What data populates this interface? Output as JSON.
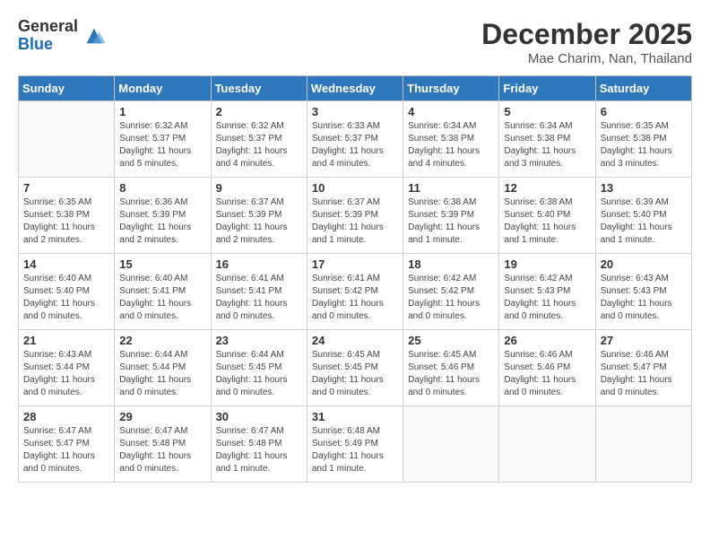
{
  "header": {
    "logo_general": "General",
    "logo_blue": "Blue",
    "month_title": "December 2025",
    "location": "Mae Charim, Nan, Thailand"
  },
  "days_of_week": [
    "Sunday",
    "Monday",
    "Tuesday",
    "Wednesday",
    "Thursday",
    "Friday",
    "Saturday"
  ],
  "weeks": [
    [
      {
        "day": "",
        "content": ""
      },
      {
        "day": "1",
        "content": "Sunrise: 6:32 AM\nSunset: 5:37 PM\nDaylight: 11 hours\nand 5 minutes."
      },
      {
        "day": "2",
        "content": "Sunrise: 6:32 AM\nSunset: 5:37 PM\nDaylight: 11 hours\nand 4 minutes."
      },
      {
        "day": "3",
        "content": "Sunrise: 6:33 AM\nSunset: 5:37 PM\nDaylight: 11 hours\nand 4 minutes."
      },
      {
        "day": "4",
        "content": "Sunrise: 6:34 AM\nSunset: 5:38 PM\nDaylight: 11 hours\nand 4 minutes."
      },
      {
        "day": "5",
        "content": "Sunrise: 6:34 AM\nSunset: 5:38 PM\nDaylight: 11 hours\nand 3 minutes."
      },
      {
        "day": "6",
        "content": "Sunrise: 6:35 AM\nSunset: 5:38 PM\nDaylight: 11 hours\nand 3 minutes."
      }
    ],
    [
      {
        "day": "7",
        "content": "Sunrise: 6:35 AM\nSunset: 5:38 PM\nDaylight: 11 hours\nand 2 minutes."
      },
      {
        "day": "8",
        "content": "Sunrise: 6:36 AM\nSunset: 5:39 PM\nDaylight: 11 hours\nand 2 minutes."
      },
      {
        "day": "9",
        "content": "Sunrise: 6:37 AM\nSunset: 5:39 PM\nDaylight: 11 hours\nand 2 minutes."
      },
      {
        "day": "10",
        "content": "Sunrise: 6:37 AM\nSunset: 5:39 PM\nDaylight: 11 hours\nand 1 minute."
      },
      {
        "day": "11",
        "content": "Sunrise: 6:38 AM\nSunset: 5:39 PM\nDaylight: 11 hours\nand 1 minute."
      },
      {
        "day": "12",
        "content": "Sunrise: 6:38 AM\nSunset: 5:40 PM\nDaylight: 11 hours\nand 1 minute."
      },
      {
        "day": "13",
        "content": "Sunrise: 6:39 AM\nSunset: 5:40 PM\nDaylight: 11 hours\nand 1 minute."
      }
    ],
    [
      {
        "day": "14",
        "content": "Sunrise: 6:40 AM\nSunset: 5:40 PM\nDaylight: 11 hours\nand 0 minutes."
      },
      {
        "day": "15",
        "content": "Sunrise: 6:40 AM\nSunset: 5:41 PM\nDaylight: 11 hours\nand 0 minutes."
      },
      {
        "day": "16",
        "content": "Sunrise: 6:41 AM\nSunset: 5:41 PM\nDaylight: 11 hours\nand 0 minutes."
      },
      {
        "day": "17",
        "content": "Sunrise: 6:41 AM\nSunset: 5:42 PM\nDaylight: 11 hours\nand 0 minutes."
      },
      {
        "day": "18",
        "content": "Sunrise: 6:42 AM\nSunset: 5:42 PM\nDaylight: 11 hours\nand 0 minutes."
      },
      {
        "day": "19",
        "content": "Sunrise: 6:42 AM\nSunset: 5:43 PM\nDaylight: 11 hours\nand 0 minutes."
      },
      {
        "day": "20",
        "content": "Sunrise: 6:43 AM\nSunset: 5:43 PM\nDaylight: 11 hours\nand 0 minutes."
      }
    ],
    [
      {
        "day": "21",
        "content": "Sunrise: 6:43 AM\nSunset: 5:44 PM\nDaylight: 11 hours\nand 0 minutes."
      },
      {
        "day": "22",
        "content": "Sunrise: 6:44 AM\nSunset: 5:44 PM\nDaylight: 11 hours\nand 0 minutes."
      },
      {
        "day": "23",
        "content": "Sunrise: 6:44 AM\nSunset: 5:45 PM\nDaylight: 11 hours\nand 0 minutes."
      },
      {
        "day": "24",
        "content": "Sunrise: 6:45 AM\nSunset: 5:45 PM\nDaylight: 11 hours\nand 0 minutes."
      },
      {
        "day": "25",
        "content": "Sunrise: 6:45 AM\nSunset: 5:46 PM\nDaylight: 11 hours\nand 0 minutes."
      },
      {
        "day": "26",
        "content": "Sunrise: 6:46 AM\nSunset: 5:46 PM\nDaylight: 11 hours\nand 0 minutes."
      },
      {
        "day": "27",
        "content": "Sunrise: 6:46 AM\nSunset: 5:47 PM\nDaylight: 11 hours\nand 0 minutes."
      }
    ],
    [
      {
        "day": "28",
        "content": "Sunrise: 6:47 AM\nSunset: 5:47 PM\nDaylight: 11 hours\nand 0 minutes."
      },
      {
        "day": "29",
        "content": "Sunrise: 6:47 AM\nSunset: 5:48 PM\nDaylight: 11 hours\nand 0 minutes."
      },
      {
        "day": "30",
        "content": "Sunrise: 6:47 AM\nSunset: 5:48 PM\nDaylight: 11 hours\nand 1 minute."
      },
      {
        "day": "31",
        "content": "Sunrise: 6:48 AM\nSunset: 5:49 PM\nDaylight: 11 hours\nand 1 minute."
      },
      {
        "day": "",
        "content": ""
      },
      {
        "day": "",
        "content": ""
      },
      {
        "day": "",
        "content": ""
      }
    ]
  ]
}
